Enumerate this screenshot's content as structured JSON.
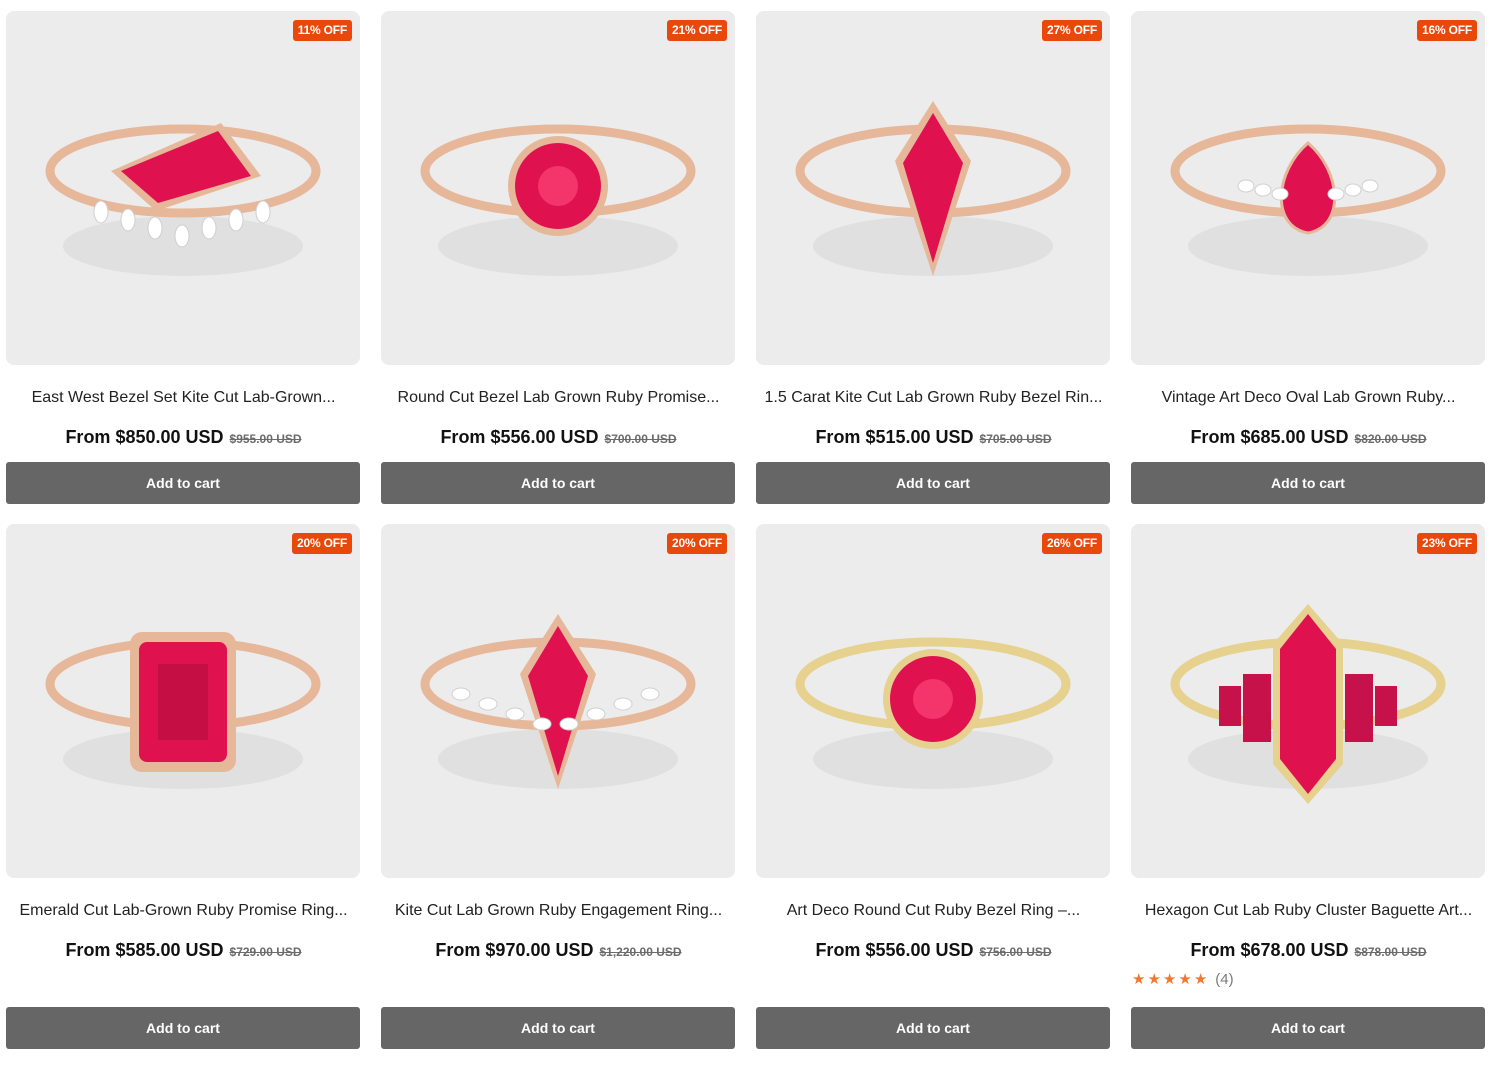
{
  "cart_label": "Add to cart",
  "products": [
    {
      "title": "East West Bezel Set Kite Cut Lab-Grown...",
      "price": "From $850.00 USD",
      "compare": "$955.00 USD",
      "badge": "11% OFF",
      "metal": "rose",
      "stone": "kite-h"
    },
    {
      "title": "Round Cut Bezel Lab Grown Ruby Promise...",
      "price": "From $556.00 USD",
      "compare": "$700.00 USD",
      "badge": "21% OFF",
      "metal": "rose",
      "stone": "round"
    },
    {
      "title": "1.5 Carat Kite Cut Lab Grown Ruby Bezel Rin...",
      "price": "From $515.00 USD",
      "compare": "$705.00 USD",
      "badge": "27% OFF",
      "metal": "rose",
      "stone": "kite-v"
    },
    {
      "title": "Vintage Art Deco Oval Lab Grown Ruby...",
      "price": "From $685.00 USD",
      "compare": "$820.00 USD",
      "badge": "16% OFF",
      "metal": "rose",
      "stone": "pear"
    },
    {
      "title": "Emerald Cut Lab-Grown Ruby Promise Ring...",
      "price": "From $585.00 USD",
      "compare": "$729.00 USD",
      "badge": "20% OFF",
      "metal": "rose",
      "stone": "emerald"
    },
    {
      "title": "Kite Cut Lab Grown Ruby Engagement Ring...",
      "price": "From $970.00 USD",
      "compare": "$1,220.00 USD",
      "badge": "20% OFF",
      "metal": "rose",
      "stone": "kite-v2"
    },
    {
      "title": "Art Deco Round Cut Ruby Bezel Ring –...",
      "price": "From $556.00 USD",
      "compare": "$756.00 USD",
      "badge": "26% OFF",
      "metal": "gold",
      "stone": "round2"
    },
    {
      "title": "Hexagon Cut Lab Ruby Cluster Baguette Art...",
      "price": "From $678.00 USD",
      "compare": "$878.00 USD",
      "badge": "23% OFF",
      "metal": "gold",
      "stone": "hex",
      "rating": 5,
      "review_count": "(4)"
    }
  ],
  "colors": {
    "badge": "#e9480b",
    "button": "#666666",
    "ruby": "#e0114f",
    "rose_gold": "#e7b79a",
    "yellow_gold": "#e6d18e",
    "star": "#f0782f"
  }
}
